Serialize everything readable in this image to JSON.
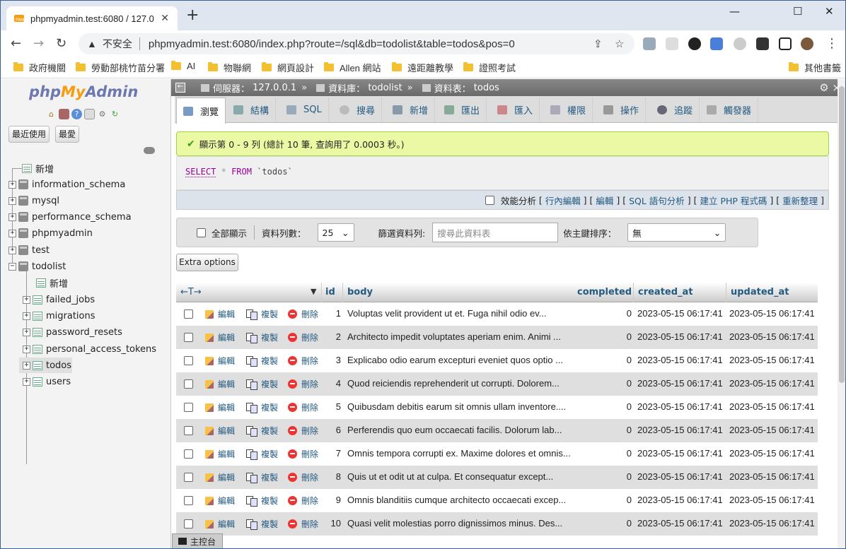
{
  "browser": {
    "tab_title": "phpmyadmin.test:6080 / 127.0",
    "close": "✕",
    "newtab": "+",
    "insecure_label": "不安全",
    "url": "phpmyadmin.test:6080/index.php?route=/sql&db=todolist&table=todos&pos=0",
    "win_min": "—",
    "win_max": "☐",
    "win_close": "✕"
  },
  "bookmarks": {
    "items": [
      "政府機關",
      "勞動部桃竹苗分署",
      "AI",
      "物聯網",
      "網頁設計",
      "Allen 網站",
      "遠距離教學",
      "證照考試"
    ],
    "other": "其他書籤"
  },
  "pma": {
    "logo_php": "php",
    "logo_my": "My",
    "logo_admin": "Admin",
    "recent": "最近使用",
    "favorites": "最愛",
    "tree": {
      "new": "新增",
      "databases": [
        "information_schema",
        "mysql",
        "performance_schema",
        "phpmyadmin",
        "test",
        "todolist"
      ],
      "todolist_new": "新增",
      "tables": [
        "failed_jobs",
        "migrations",
        "password_resets",
        "personal_access_tokens",
        "todos",
        "users"
      ]
    }
  },
  "breadcrumb": {
    "server_label": "伺服器：",
    "server": "127.0.0.1",
    "db_label": "資料庫：",
    "db": "todolist",
    "table_label": "資料表：",
    "table": "todos",
    "sep": "»"
  },
  "tabs": [
    "瀏覽",
    "結構",
    "SQL",
    "搜尋",
    "新增",
    "匯出",
    "匯入",
    "權限",
    "操作",
    "追蹤",
    "觸發器"
  ],
  "message": {
    "ok_icon": "✔",
    "text": "顯示第 0 - 9 列 (總計 10 筆, 查詢用了 0.0003 秒。)"
  },
  "sql": {
    "select": "SELECT",
    "star": "*",
    "from": "FROM",
    "table": "`todos`"
  },
  "sql_options": {
    "profiling": "效能分析",
    "links": [
      "行內編輯",
      "編輯",
      "SQL 語句分析",
      "建立 PHP 程式碼",
      "重新整理"
    ]
  },
  "navbar": {
    "show_all": "全部顯示",
    "rows_label": "資料列數：",
    "rows_value": "25",
    "filter_label": "篩選資料列:",
    "filter_placeholder": "搜尋此資料表",
    "sort_label": "依主鍵排序：",
    "sort_value": "無"
  },
  "extra_options": "Extra options",
  "grid": {
    "arrows": "←T→",
    "columns": [
      "id",
      "body",
      "completed",
      "created_at",
      "updated_at"
    ],
    "actions": {
      "edit": "編輯",
      "copy": "複製",
      "delete": "刪除"
    },
    "rows": [
      {
        "id": "1",
        "body": "Voluptas velit provident ut et. Fuga nihil odio ev...",
        "completed": "0",
        "created_at": "2023-05-15 06:17:41",
        "updated_at": "2023-05-15 06:17:41"
      },
      {
        "id": "2",
        "body": "Architecto impedit voluptates aperiam enim. Animi ...",
        "completed": "0",
        "created_at": "2023-05-15 06:17:41",
        "updated_at": "2023-05-15 06:17:41"
      },
      {
        "id": "3",
        "body": "Explicabo odio earum excepturi eveniet quos optio ...",
        "completed": "0",
        "created_at": "2023-05-15 06:17:41",
        "updated_at": "2023-05-15 06:17:41"
      },
      {
        "id": "4",
        "body": "Quod reiciendis reprehenderit ut corrupti. Dolorem...",
        "completed": "0",
        "created_at": "2023-05-15 06:17:41",
        "updated_at": "2023-05-15 06:17:41"
      },
      {
        "id": "5",
        "body": "Quibusdam debitis earum sit omnis ullam inventore....",
        "completed": "0",
        "created_at": "2023-05-15 06:17:41",
        "updated_at": "2023-05-15 06:17:41"
      },
      {
        "id": "6",
        "body": "Perferendis quo eum occaecati facilis. Dolorum lab...",
        "completed": "0",
        "created_at": "2023-05-15 06:17:41",
        "updated_at": "2023-05-15 06:17:41"
      },
      {
        "id": "7",
        "body": "Omnis tempora corrupti ex. Maxime dolores et omnis...",
        "completed": "0",
        "created_at": "2023-05-15 06:17:41",
        "updated_at": "2023-05-15 06:17:41"
      },
      {
        "id": "8",
        "body": "Quis ut et odit ut at culpa. Et consequatur except...",
        "completed": "0",
        "created_at": "2023-05-15 06:17:41",
        "updated_at": "2023-05-15 06:17:41"
      },
      {
        "id": "9",
        "body": "Omnis blanditiis cumque architecto occaecati excep...",
        "completed": "0",
        "created_at": "2023-05-15 06:17:41",
        "updated_at": "2023-05-15 06:17:41"
      },
      {
        "id": "10",
        "body": "Quasi velit molestias porro dignissimos minus. Des...",
        "completed": "0",
        "created_at": "2023-05-15 06:17:41",
        "updated_at": "2023-05-15 06:17:41"
      }
    ]
  },
  "console": "主控台"
}
